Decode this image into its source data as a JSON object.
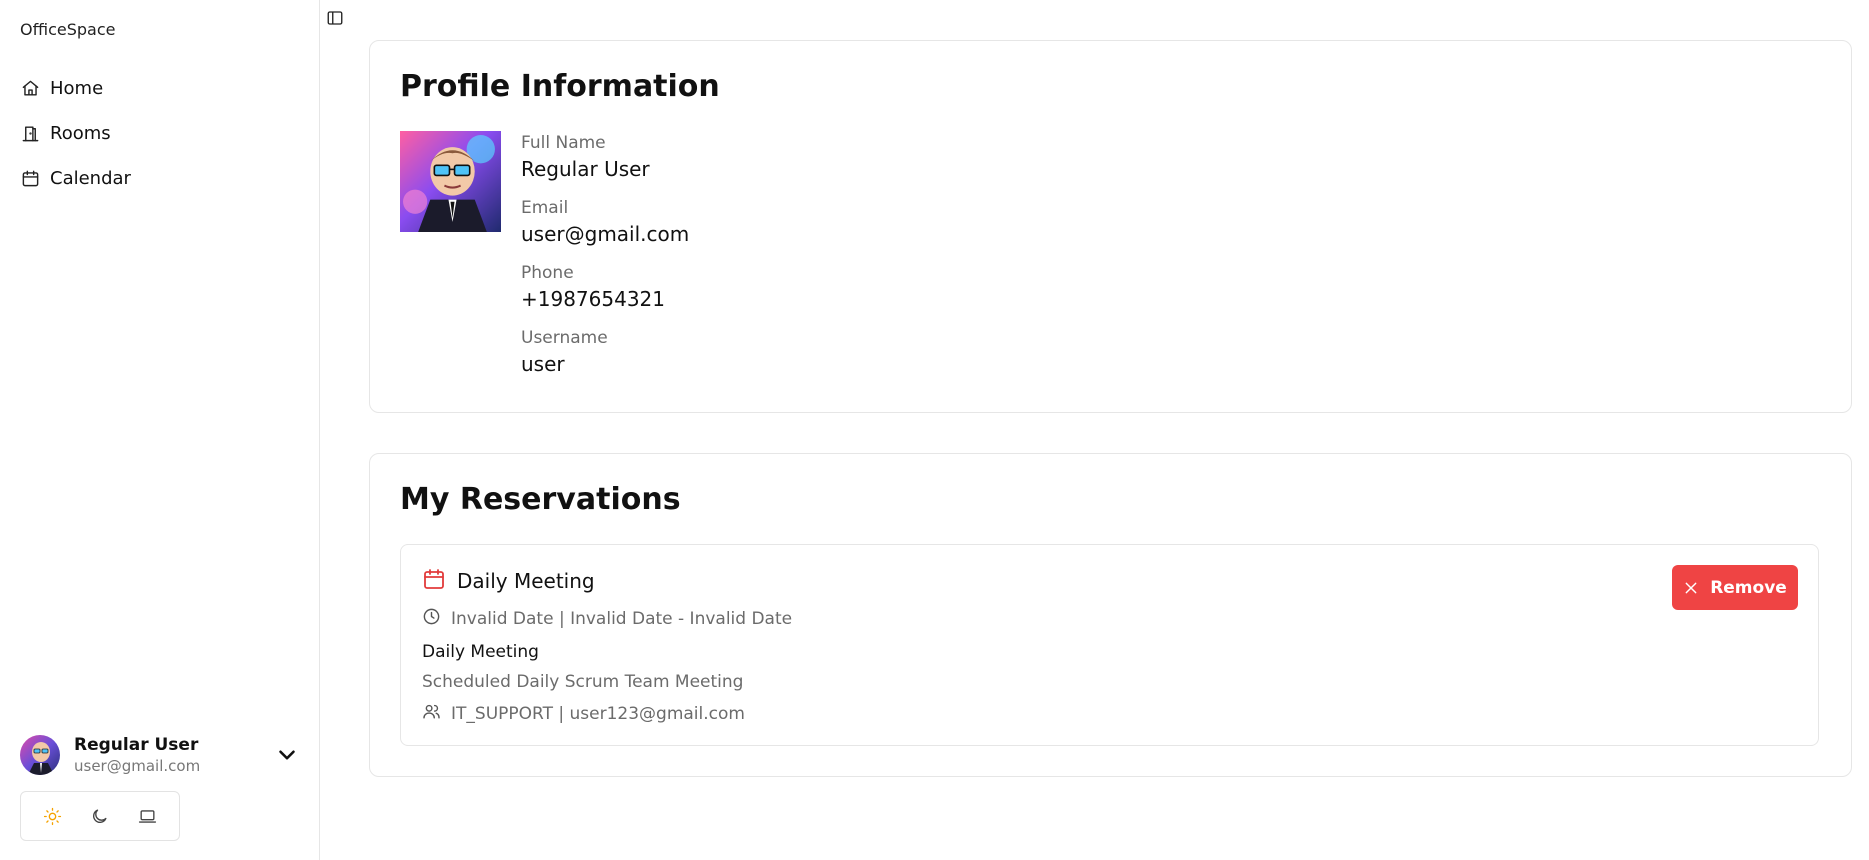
{
  "app": {
    "brand": "OfficeSpace"
  },
  "sidebar": {
    "items": [
      {
        "label": "Home",
        "icon": "home-icon"
      },
      {
        "label": "Rooms",
        "icon": "door-icon"
      },
      {
        "label": "Calendar",
        "icon": "calendar-icon"
      }
    ],
    "user": {
      "name": "Regular User",
      "email": "user@gmail.com"
    },
    "theme": {
      "options": [
        "light",
        "dark",
        "system"
      ],
      "active": "light",
      "active_color": "#f5a300"
    }
  },
  "profile": {
    "title": "Profile Information",
    "fields": [
      {
        "label": "Full Name",
        "value": "Regular User"
      },
      {
        "label": "Email",
        "value": "user@gmail.com"
      },
      {
        "label": "Phone",
        "value": "+1987654321"
      },
      {
        "label": "Username",
        "value": "user"
      }
    ]
  },
  "reservations": {
    "title": "My Reservations",
    "items": [
      {
        "title": "Daily Meeting",
        "time": "Invalid Date | Invalid Date - Invalid Date",
        "name": "Daily Meeting",
        "description": "Scheduled Daily Scrum Team Meeting",
        "people": "IT_SUPPORT | user123@gmail.com",
        "remove_label": "Remove"
      }
    ]
  },
  "colors": {
    "accent_red": "#ef4444",
    "calendar_icon": "#e23b3b"
  }
}
